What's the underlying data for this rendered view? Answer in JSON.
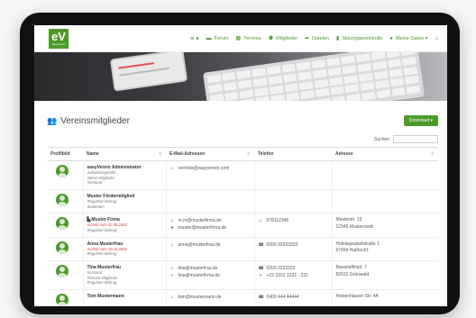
{
  "nav": {
    "logo": "eV",
    "logo_sub": "Easyverein",
    "items": [
      {
        "icon": "menu-icon",
        "label": ""
      },
      {
        "icon": "forum-icon",
        "label": "Forum"
      },
      {
        "icon": "calendar-icon",
        "label": "Termine"
      },
      {
        "icon": "members-icon",
        "label": "Mitglieder"
      },
      {
        "icon": "share-icon",
        "label": "Dateien"
      },
      {
        "icon": "file-icon",
        "label": "Sitzungsprotokolle"
      },
      {
        "icon": "user-icon",
        "label": "Meine Daten ▾"
      },
      {
        "icon": "home-icon",
        "label": ""
      }
    ]
  },
  "page": {
    "title": "Vereinsmitglieder",
    "download_label": "Download ▾",
    "search_label": "Suchen"
  },
  "table": {
    "columns": [
      "Profilbild",
      "Name",
      "E-Mail-Adressen",
      "Telefon",
      "Adresse"
    ],
    "rows": [
      {
        "name": "easyVerein Administrator",
        "subs": [
          "Aufnahmegebühr",
          "Aktive Mitglieder",
          "Vorstand"
        ],
        "emails": [
          {
            "icon": "home-icon",
            "value": "vertrieb@easyverein.com"
          }
        ],
        "phones": [],
        "address": []
      },
      {
        "name": "Muster Fördermitglied",
        "subs": [
          "Regulärer Beitrag",
          "Studenten"
        ],
        "emails": [],
        "phones": [],
        "address": []
      },
      {
        "name": "Muster Firma",
        "company": true,
        "subs_red": [
          "Austritt zum 02.09.2020"
        ],
        "subs": [
          "Regulärer Beitrag"
        ],
        "emails": [
          {
            "icon": "home-icon",
            "value": "m.m@musterfirma.de"
          },
          {
            "icon": "user-icon",
            "value": "muster@musterfirma.de"
          }
        ],
        "phones": [
          {
            "icon": "home-icon",
            "value": "078112345"
          }
        ],
        "address": [
          "Musterstr. 10",
          "12345 Musterstadt"
        ]
      },
      {
        "name": "Anna Musterfrau",
        "subs_red": [
          "Austritt zum 19.10.2020"
        ],
        "subs": [
          "Regulärer Beitrag"
        ],
        "emails": [
          {
            "icon": "home-icon",
            "value": "anna@musterfrau.de"
          }
        ],
        "phones": [
          {
            "icon": "phone-icon",
            "value": "0200 33333333"
          }
        ],
        "address": [
          "Holidaypalaststraße 1",
          "67454 Haßloch1"
        ]
      },
      {
        "name": "Tina Musterfrau",
        "subs": [
          "Vorstand",
          "Passive Mitglieder",
          "Regulärer Beitrag"
        ],
        "emails": [
          {
            "icon": "home-icon",
            "value": "tina@musterfrau.de"
          },
          {
            "icon": "work-icon",
            "value": "tina@musterfirma.de"
          }
        ],
        "phones": [
          {
            "icon": "phone-icon",
            "value": "0200 2222222"
          },
          {
            "icon": "work-icon",
            "value": "+22 2222 2222 - 222"
          }
        ],
        "address": [
          "Bavariafilmpl. 7",
          "82031 Grünwald"
        ]
      },
      {
        "name": "Tom Mustermann",
        "subs": [],
        "emails": [
          {
            "icon": "home-icon",
            "value": "tom@mustermann.de"
          }
        ],
        "phones": [
          {
            "icon": "phone-icon",
            "value": "0400 444 44444"
          }
        ],
        "address": [
          "Heisenhäuser Str. 4A"
        ]
      }
    ]
  }
}
